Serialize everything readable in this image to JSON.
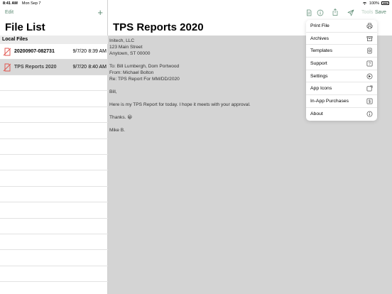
{
  "status": {
    "time": "8:41 AM",
    "date": "Mon Sep 7",
    "battery": "100%"
  },
  "sidebar": {
    "edit_label": "Edit",
    "add_label": "+",
    "title": "File List",
    "section": "Local Files",
    "files": [
      {
        "name": "20200907-082731",
        "date": "9/7/20",
        "time": "8:39 AM",
        "selected": false
      },
      {
        "name": "TPS Reports 2020",
        "date": "9/7/20",
        "time": "8:40 AM",
        "selected": true
      }
    ]
  },
  "main": {
    "title": "TPS Reports 2020",
    "tools_label": "Tools",
    "save_label": "Save",
    "body": {
      "address1": "Initech, LLC",
      "address2": "123 Main Street",
      "address3": "Anytown, ST 00000",
      "to": "To: Bill Lumbergh, Dom Portwood",
      "from": "From: Michael Bolton",
      "re": "Re: TPS Report For MM/DD/2020",
      "greeting": "Bill,",
      "message": "Here is my TPS Report for today. I hope it meets with your approval.",
      "thanks": "Thanks. 😀",
      "signature": "Mike B."
    }
  },
  "menu": {
    "items": [
      {
        "label": "Print File",
        "icon": "printer-icon"
      },
      {
        "label": "Archives",
        "icon": "archive-box-icon"
      },
      {
        "label": "Templates",
        "icon": "template-icon"
      },
      {
        "label": "Support",
        "icon": "question-icon"
      },
      {
        "label": "Settings",
        "icon": "gear-icon"
      },
      {
        "label": "App Icons",
        "icon": "app-icon"
      },
      {
        "label": "In-App Purchases",
        "icon": "dollar-icon"
      },
      {
        "label": "About",
        "icon": "info-icon"
      }
    ]
  },
  "colors": {
    "accent": "#5b8a72",
    "file_icon": "#e0524b",
    "doc_bg": "#d4d4d4"
  }
}
